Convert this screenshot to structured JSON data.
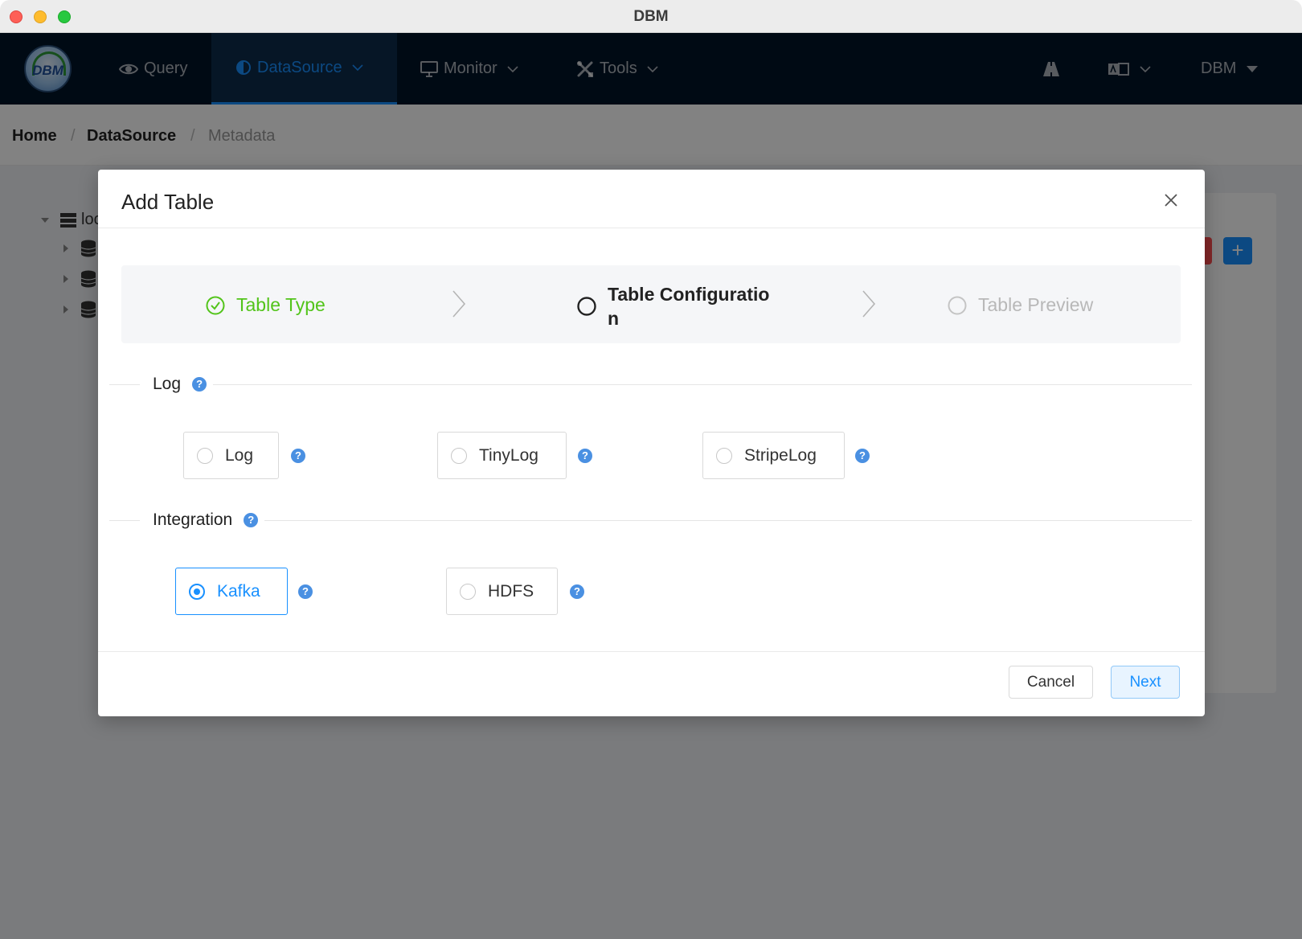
{
  "window": {
    "title": "DBM"
  },
  "navbar": {
    "items": [
      {
        "label": "Query",
        "icon": "eye-icon"
      },
      {
        "label": "DataSource",
        "icon": "half-circle-icon",
        "active": true
      },
      {
        "label": "Monitor",
        "icon": "monitor-icon"
      },
      {
        "label": "Tools",
        "icon": "tools-icon"
      }
    ],
    "user_label": "DBM"
  },
  "breadcrumb": {
    "items": [
      "Home",
      "DataSource",
      "Metadata"
    ],
    "separator": "/"
  },
  "tree": {
    "root_label": "loc"
  },
  "modal": {
    "title": "Add Table",
    "steps": [
      {
        "label": "Table Type",
        "status": "finished"
      },
      {
        "label": "Table Configuratio",
        "label_wrap": "n",
        "status": "process"
      },
      {
        "label": "Table Preview",
        "status": "wait"
      }
    ],
    "sections": [
      {
        "label": "Log",
        "options": [
          {
            "label": "Log",
            "checked": false
          },
          {
            "label": "TinyLog",
            "checked": false
          },
          {
            "label": "StripeLog",
            "checked": false
          }
        ]
      },
      {
        "label": "Integration",
        "options": [
          {
            "label": "Kafka",
            "checked": true
          },
          {
            "label": "HDFS",
            "checked": false
          }
        ]
      }
    ],
    "help_glyph": "?",
    "footer": {
      "cancel_label": "Cancel",
      "next_label": "Next"
    }
  },
  "colors": {
    "primary": "#1890ff",
    "success": "#52c41a",
    "nav_bg": "#001529"
  }
}
